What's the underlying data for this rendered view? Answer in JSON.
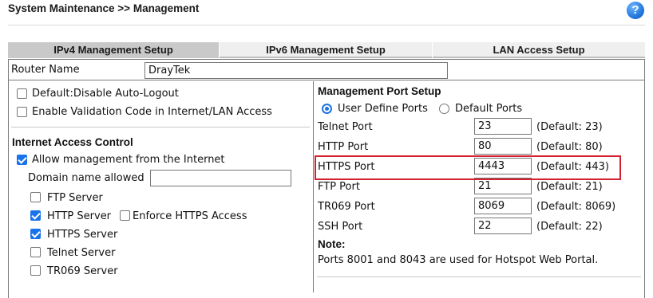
{
  "header": {
    "title": "System Maintenance >> Management",
    "help_icon": "?"
  },
  "tabs": [
    {
      "label": "IPv4 Management Setup",
      "active": true
    },
    {
      "label": "IPv6 Management Setup",
      "active": false
    },
    {
      "label": "LAN Access Setup",
      "active": false
    }
  ],
  "router_name": {
    "label": "Router Name",
    "value": "DrayTek"
  },
  "left": {
    "options": [
      {
        "label": "Default:Disable Auto-Logout",
        "checked": false
      },
      {
        "label": "Enable Validation Code in Internet/LAN Access",
        "checked": false
      }
    ],
    "internet_access": {
      "heading": "Internet Access Control",
      "allow_label": "Allow management from the Internet",
      "allow_checked": true,
      "domain_label": "Domain name allowed",
      "domain_value": "",
      "servers": [
        {
          "label": "FTP Server",
          "checked": false
        },
        {
          "label": "HTTP Server",
          "checked": true
        },
        {
          "label": "HTTPS Server",
          "checked": true
        },
        {
          "label": "Telnet Server",
          "checked": false
        },
        {
          "label": "TR069 Server",
          "checked": false
        }
      ],
      "enforce_https_label": "Enforce HTTPS Access",
      "enforce_https_checked": false
    }
  },
  "right": {
    "heading": "Management Port Setup",
    "radio_user": "User Define Ports",
    "radio_default": "Default Ports",
    "selected": "user",
    "ports": [
      {
        "label": "Telnet Port",
        "value": "23",
        "default": "(Default: 23)"
      },
      {
        "label": "HTTP Port",
        "value": "80",
        "default": "(Default: 80)"
      },
      {
        "label": "HTTPS Port",
        "value": "4443",
        "default": "(Default: 443)"
      },
      {
        "label": "FTP Port",
        "value": "21",
        "default": "(Default: 21)"
      },
      {
        "label": "TR069 Port",
        "value": "8069",
        "default": "(Default: 8069)"
      },
      {
        "label": "SSH Port",
        "value": "22",
        "default": "(Default: 22)"
      }
    ],
    "note_heading": "Note:",
    "note_text": "Ports 8001 and 8043 are used for Hotspot Web Portal."
  },
  "colors": {
    "accent": "#1a73e8",
    "highlight": "#d4212f",
    "tab_active": "#c9c9c9",
    "tab_bg": "#efefef"
  }
}
